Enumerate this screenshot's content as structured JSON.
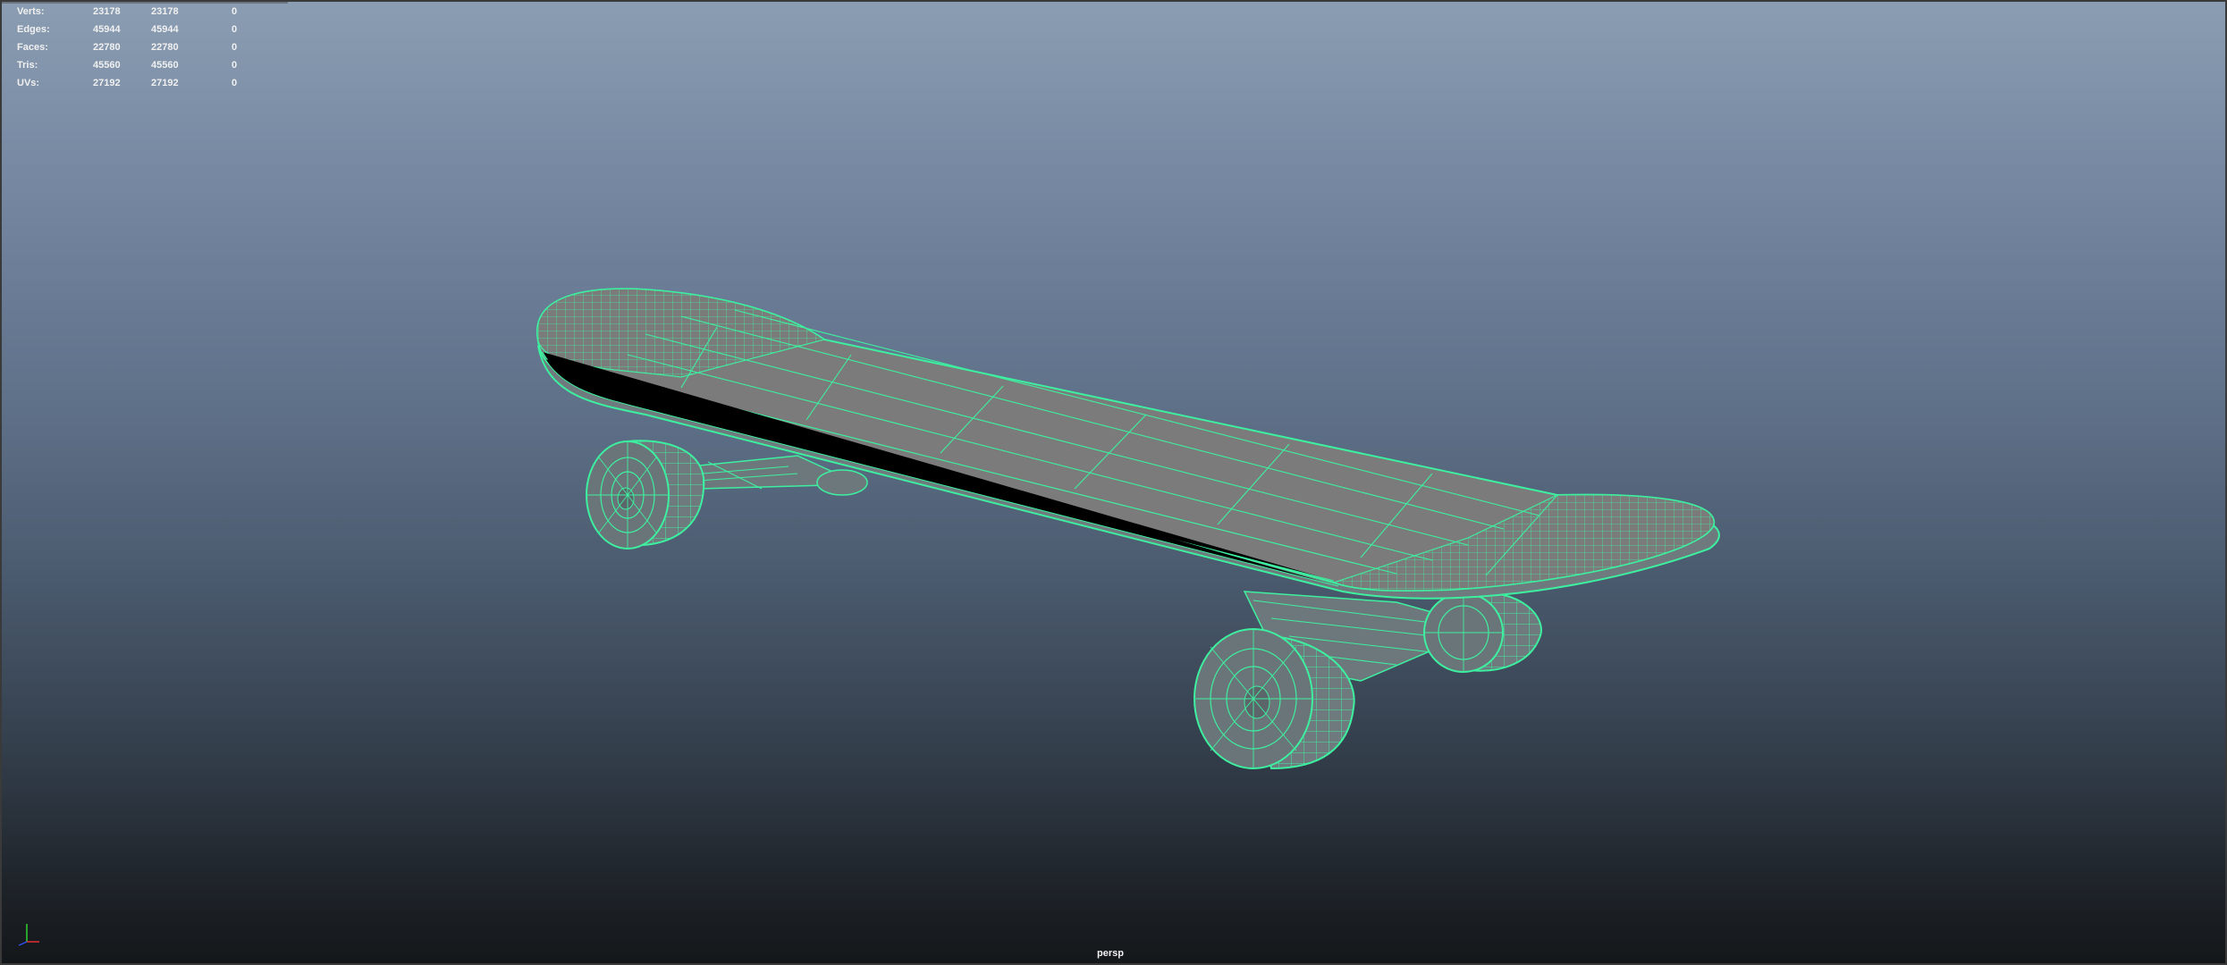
{
  "hud": {
    "rows": [
      {
        "label": "Verts:",
        "v1": "23178",
        "v2": "23178",
        "v3": "0"
      },
      {
        "label": "Edges:",
        "v1": "45944",
        "v2": "45944",
        "v3": "0"
      },
      {
        "label": "Faces:",
        "v1": "22780",
        "v2": "22780",
        "v3": "0"
      },
      {
        "label": "Tris:",
        "v1": "45560",
        "v2": "45560",
        "v3": "0"
      },
      {
        "label": "UVs:",
        "v1": "27192",
        "v2": "27192",
        "v3": "0"
      }
    ]
  },
  "viewport": {
    "camera": "persp"
  },
  "colors": {
    "wireframe": "#3df0a0",
    "deck_fill": "#7b7b7b",
    "gradient_top": "#8b9db2",
    "gradient_bottom": "#14171a",
    "axis_x": "#e03030",
    "axis_y": "#30d030",
    "axis_z": "#3050f0"
  },
  "icons": {
    "axis": "xyz-axis-gizmo-icon"
  }
}
